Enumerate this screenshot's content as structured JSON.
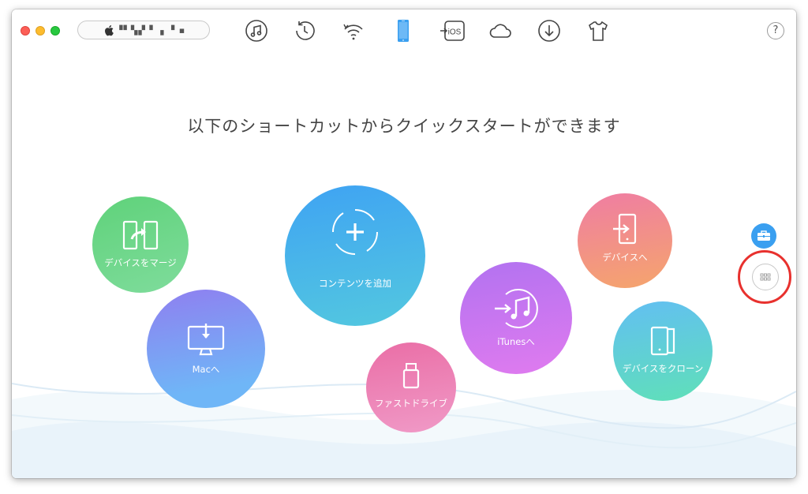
{
  "window": {
    "device_name": "▝▘▚▞ ▘ ▖▝ ▪",
    "help_label": "?"
  },
  "toolbar": {
    "icons": [
      "music-icon",
      "history-icon",
      "wifi-sync-icon",
      "iphone-icon",
      "to-ios-icon",
      "cloud-icon",
      "download-icon",
      "tshirt-icon"
    ],
    "active": "iphone-icon",
    "ios_text": "iOS"
  },
  "main": {
    "heading": "以下のショートカットからクイックスタートができます"
  },
  "shortcuts": {
    "merge": "デバイスをマージ",
    "mac": "Macへ",
    "add": "コンテンツを追加",
    "drive": "ファストドライブ",
    "itunes": "iTunesへ",
    "to_device": "デバイスへ",
    "clone": "デバイスをクローン"
  },
  "colors": {
    "accent": "#3a9ff0",
    "highlight_ring": "#e8312e"
  }
}
